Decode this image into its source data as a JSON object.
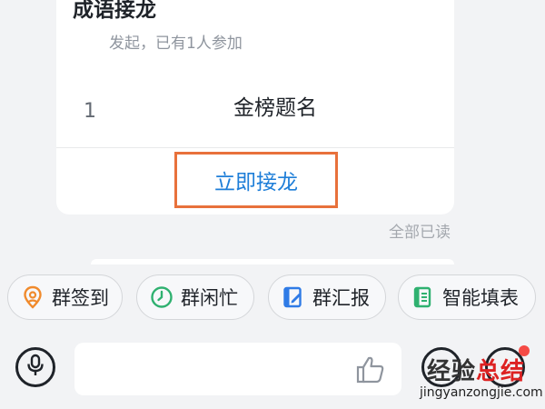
{
  "card": {
    "title": "成语接龙",
    "subtitle": "发起，已有1人参加",
    "entries": [
      {
        "index": "1",
        "text": "金榜题名"
      }
    ],
    "relay_button": "立即接龙"
  },
  "read_status": "全部已读",
  "quick_actions": [
    {
      "label": "群签到",
      "icon": "location-pin-icon",
      "color": "#f08a2c"
    },
    {
      "label": "群闲忙",
      "icon": "clock-icon",
      "color": "#2fb170"
    },
    {
      "label": "群汇报",
      "icon": "report-edit-icon",
      "color": "#2f7be6"
    },
    {
      "label": "智能填表",
      "icon": "form-sheet-icon",
      "color": "#2fb170"
    }
  ],
  "input": {
    "placeholder": ""
  },
  "watermark": {
    "main_a": "经验",
    "main_b": "总结",
    "url": "jingyanzongjie.com"
  }
}
